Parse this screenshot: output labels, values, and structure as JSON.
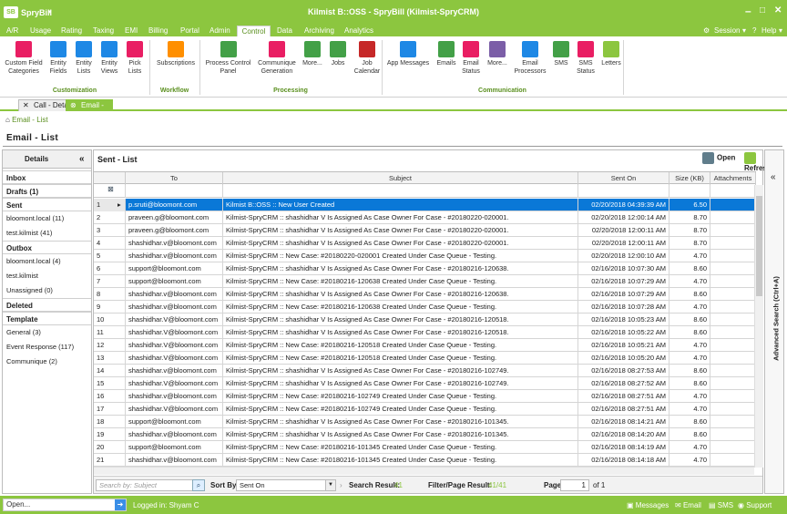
{
  "app": {
    "name": "SpryBill",
    "logo": "SB",
    "window_title": "Kilmist B::OSS - SpryBill (Kilmist-SpryCRM)"
  },
  "window_controls": {
    "minimize": "–",
    "maximize": "□",
    "close": "✕"
  },
  "menu": {
    "items": [
      "A/R",
      "Usage",
      "Rating",
      "Taxing",
      "EMI",
      "Billing",
      "Portal",
      "Admin",
      "Control",
      "Data",
      "Archiving",
      "Analytics"
    ],
    "active": "Control",
    "session": "Session",
    "help": "Help"
  },
  "ribbon": {
    "buttons": [
      {
        "label1": "Custom Field",
        "label2": "Categories",
        "icon": "list-icon",
        "color": "#e91e63"
      },
      {
        "label1": "Entity",
        "label2": "Fields",
        "icon": "fields-icon",
        "color": "#1e88e5"
      },
      {
        "label1": "Entity",
        "label2": "Lists",
        "icon": "lists-icon",
        "color": "#1e88e5"
      },
      {
        "label1": "Entity",
        "label2": "Views",
        "icon": "views-icon",
        "color": "#1e88e5"
      },
      {
        "label1": "Pick",
        "label2": "Lists",
        "icon": "picklist-icon",
        "color": "#e91e63"
      },
      {
        "label1": "Subscriptions",
        "label2": "",
        "icon": "rss-icon",
        "color": "#ff8f00"
      },
      {
        "label1": "Process Control",
        "label2": "Panel",
        "icon": "process-icon",
        "color": "#43a047"
      },
      {
        "label1": "Communique",
        "label2": "Generation",
        "icon": "communique-icon",
        "color": "#e91e63"
      },
      {
        "label1": "More...",
        "label2": "",
        "icon": "more-icon",
        "color": "#43a047"
      },
      {
        "label1": "Jobs",
        "label2": "",
        "icon": "jobs-icon",
        "color": "#43a047"
      },
      {
        "label1": "Job",
        "label2": "Calendar",
        "icon": "calendar-icon",
        "color": "#c62828"
      },
      {
        "label1": "App Messages",
        "label2": "",
        "icon": "chat-icon",
        "color": "#1e88e5"
      },
      {
        "label1": "Emails",
        "label2": "",
        "icon": "mail-icon",
        "color": "#43a047"
      },
      {
        "label1": "Email",
        "label2": "Status",
        "icon": "mail-status-icon",
        "color": "#e91e63"
      },
      {
        "label1": "More...",
        "label2": "",
        "icon": "more-icon",
        "color": "#7b5ea7"
      },
      {
        "label1": "Email",
        "label2": "Processors",
        "icon": "processors-icon",
        "color": "#1e88e5"
      },
      {
        "label1": "SMS",
        "label2": "",
        "icon": "sms-icon",
        "color": "#43a047"
      },
      {
        "label1": "SMS",
        "label2": "Status",
        "icon": "sms-status-icon",
        "color": "#e91e63"
      },
      {
        "label1": "Letters",
        "label2": "",
        "icon": "letters-icon",
        "color": "#8cc63f"
      }
    ],
    "groups": [
      "Customization",
      "Workflow",
      "Processing",
      "Communication"
    ]
  },
  "tabs": [
    {
      "label": "Call - Detail"
    },
    {
      "label": "Email - List"
    }
  ],
  "breadcrumb": "Email - List",
  "page_title": "Email - List",
  "details": {
    "title": "Details",
    "collapse": "«",
    "items": [
      {
        "label": "Inbox",
        "type": "h"
      },
      {
        "label": "Drafts (1)",
        "type": "h"
      },
      {
        "label": "Sent",
        "type": "h"
      },
      {
        "label": "bloomont.local (11)",
        "type": "i"
      },
      {
        "label": "test.kilmist (41)",
        "type": "i"
      },
      {
        "label": "Outbox",
        "type": "h"
      },
      {
        "label": "bloomont.local (4)",
        "type": "i"
      },
      {
        "label": "test.kilmist",
        "type": "i"
      },
      {
        "label": "Unassigned (0)",
        "type": "i"
      },
      {
        "label": "Deleted",
        "type": "h"
      },
      {
        "label": "Template",
        "type": "h"
      },
      {
        "label": "General (3)",
        "type": "i"
      },
      {
        "label": "Event Response (117)",
        "type": "i"
      },
      {
        "label": "Communique (2)",
        "type": "i"
      }
    ]
  },
  "list": {
    "title": "Sent - List",
    "open": "Open",
    "refresh": "Refresh",
    "columns": [
      "To",
      "Subject",
      "Sent On",
      "Size (KB)",
      "Attachments"
    ],
    "rows": [
      {
        "n": "1",
        "to": "p.sruti@bloomont.com",
        "subject": "Kilmist B::OSS :: New User Created",
        "sent": "02/20/2018 04:39:39 AM",
        "size": "6.50"
      },
      {
        "n": "2",
        "to": "praveen.g@bloomont.com",
        "subject": "Kilmist-SpryCRM :: shashidhar V Is Assigned As Case Owner For Case - #20180220-020001.",
        "sent": "02/20/2018 12:00:14 AM",
        "size": "8.70"
      },
      {
        "n": "3",
        "to": "praveen.g@bloomont.com",
        "subject": "Kilmist-SpryCRM :: shashidhar V Is Assigned As Case Owner For Case - #20180220-020001.",
        "sent": "02/20/2018 12:00:11 AM",
        "size": "8.70"
      },
      {
        "n": "4",
        "to": "shashidhar.v@bloomont.com",
        "subject": "Kilmist-SpryCRM :: shashidhar V Is Assigned As Case Owner For Case - #20180220-020001.",
        "sent": "02/20/2018 12:00:11 AM",
        "size": "8.70"
      },
      {
        "n": "5",
        "to": "shashidhar.v@bloomont.com",
        "subject": "Kilmist-SpryCRM :: New Case: #20180220-020001 Created Under Case Queue - Testing.",
        "sent": "02/20/2018 12:00:10 AM",
        "size": "4.70"
      },
      {
        "n": "6",
        "to": "support@bloomont.com",
        "subject": "Kilmist-SpryCRM :: shashidhar V Is Assigned As Case Owner For Case - #20180216-120638.",
        "sent": "02/16/2018 10:07:30 AM",
        "size": "8.60"
      },
      {
        "n": "7",
        "to": "support@bloomont.com",
        "subject": "Kilmist-SpryCRM :: New Case: #20180216-120638 Created Under Case Queue - Testing.",
        "sent": "02/16/2018 10:07:29 AM",
        "size": "4.70"
      },
      {
        "n": "8",
        "to": "shashidhar.v@bloomont.com",
        "subject": "Kilmist-SpryCRM :: shashidhar V Is Assigned As Case Owner For Case - #20180216-120638.",
        "sent": "02/16/2018 10:07:29 AM",
        "size": "8.60"
      },
      {
        "n": "9",
        "to": "shashidhar.v@bloomont.com",
        "subject": "Kilmist-SpryCRM :: New Case: #20180216-120638 Created Under Case Queue - Testing.",
        "sent": "02/16/2018 10:07:28 AM",
        "size": "4.70"
      },
      {
        "n": "10",
        "to": "shashidhar.V@bloomont.com",
        "subject": "Kilmist-SpryCRM :: shashidhar V Is Assigned As Case Owner For Case - #20180216-120518.",
        "sent": "02/16/2018 10:05:23 AM",
        "size": "8.60"
      },
      {
        "n": "11",
        "to": "shashidhar.V@bloomont.com",
        "subject": "Kilmist-SpryCRM :: shashidhar V Is Assigned As Case Owner For Case - #20180216-120518.",
        "sent": "02/16/2018 10:05:22 AM",
        "size": "8.60"
      },
      {
        "n": "12",
        "to": "shashidhar.V@bloomont.com",
        "subject": "Kilmist-SpryCRM :: New Case: #20180216-120518 Created Under Case Queue - Testing.",
        "sent": "02/16/2018 10:05:21 AM",
        "size": "4.70"
      },
      {
        "n": "13",
        "to": "shashidhar.V@bloomont.com",
        "subject": "Kilmist-SpryCRM :: New Case: #20180216-120518 Created Under Case Queue - Testing.",
        "sent": "02/16/2018 10:05:20 AM",
        "size": "4.70"
      },
      {
        "n": "14",
        "to": "shashidhar.v@bloomont.com",
        "subject": "Kilmist-SpryCRM :: shashidhar V Is Assigned As Case Owner For Case - #20180216-102749.",
        "sent": "02/16/2018 08:27:53 AM",
        "size": "8.60"
      },
      {
        "n": "15",
        "to": "shashidhar.V@bloomont.com",
        "subject": "Kilmist-SpryCRM :: shashidhar V Is Assigned As Case Owner For Case - #20180216-102749.",
        "sent": "02/16/2018 08:27:52 AM",
        "size": "8.60"
      },
      {
        "n": "16",
        "to": "shashidhar.v@bloomont.com",
        "subject": "Kilmist-SpryCRM :: New Case: #20180216-102749 Created Under Case Queue - Testing.",
        "sent": "02/16/2018 08:27:51 AM",
        "size": "4.70"
      },
      {
        "n": "17",
        "to": "shashidhar.V@bloomont.com",
        "subject": "Kilmist-SpryCRM :: New Case: #20180216-102749 Created Under Case Queue - Testing.",
        "sent": "02/16/2018 08:27:51 AM",
        "size": "4.70"
      },
      {
        "n": "18",
        "to": "support@bloomont.com",
        "subject": "Kilmist-SpryCRM :: shashidhar V Is Assigned As Case Owner For Case - #20180216-101345.",
        "sent": "02/16/2018 08:14:21 AM",
        "size": "8.60"
      },
      {
        "n": "19",
        "to": "shashidhar.v@bloomont.com",
        "subject": "Kilmist-SpryCRM :: shashidhar V Is Assigned As Case Owner For Case - #20180216-101345.",
        "sent": "02/16/2018 08:14:20 AM",
        "size": "8.60"
      },
      {
        "n": "20",
        "to": "support@bloomont.com",
        "subject": "Kilmist-SpryCRM :: New Case: #20180216-101345 Created Under Case Queue - Testing.",
        "sent": "02/16/2018 08:14:19 AM",
        "size": "4.70"
      },
      {
        "n": "21",
        "to": "shashidhar.v@bloomont.com",
        "subject": "Kilmist-SpryCRM :: New Case: #20180216-101345 Created Under Case Queue - Testing.",
        "sent": "02/16/2018 08:14:18 AM",
        "size": "4.70"
      }
    ],
    "search_placeholder": "Search by: Subject",
    "sort_by_label": "Sort By:",
    "sort_value": "Sent On",
    "search_result_label": "Search Result:",
    "search_result": "41",
    "filter_result_label": "Filter/Page Result:",
    "filter_result": "41/41",
    "page_label": "Page",
    "page": "1",
    "page_of": "of 1"
  },
  "adv_search": "Advanced Search (Ctrl+A)",
  "status": {
    "open_placeholder": "Open...",
    "logged_in": "Logged in: Shyam C",
    "messages": "Messages",
    "email": "Email",
    "sms": "SMS",
    "support": "Support"
  },
  "colors": {
    "accent": "#8cc63f",
    "selected": "#0a78d7"
  }
}
